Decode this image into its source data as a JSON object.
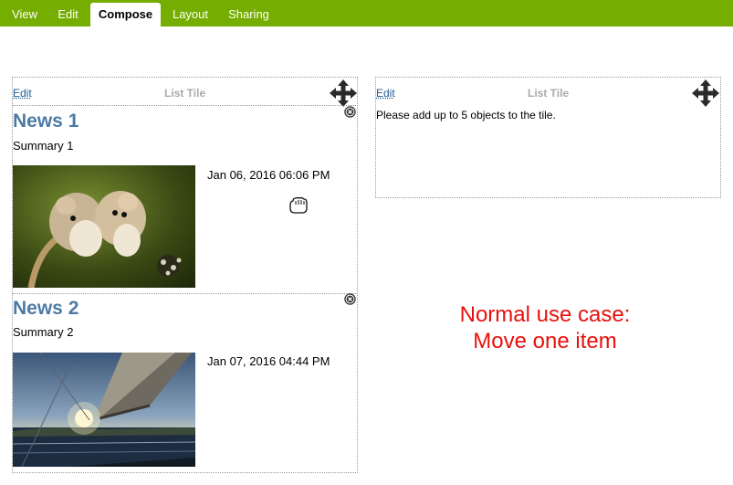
{
  "tabs": [
    {
      "label": "View"
    },
    {
      "label": "Edit"
    },
    {
      "label": "Compose",
      "active": true
    },
    {
      "label": "Layout"
    },
    {
      "label": "Sharing"
    }
  ],
  "colors": {
    "tabbar": "#75ad00",
    "link": "#205c90",
    "news_title": "#4d7ba5",
    "note": "#e8100c"
  },
  "left_tile": {
    "edit_label": "Edit",
    "title": "List Tile",
    "move_icon": "move-arrows-icon",
    "items": [
      {
        "title": "News 1",
        "summary": "Summary 1",
        "date": "Jan 06, 2016 06:06 PM",
        "image": "two-mice-photo",
        "remove_icon": "remove-circle-icon"
      },
      {
        "title": "News 2",
        "summary": "Summary 2",
        "date": "Jan 07, 2016 04:44 PM",
        "image": "sailboat-sunset-photo",
        "remove_icon": "remove-circle-icon"
      }
    ],
    "drag_cursor_icon": "grab-hand-icon"
  },
  "right_tile": {
    "edit_label": "Edit",
    "title": "List Tile",
    "move_icon": "move-arrows-icon",
    "message": "Please add up to 5 objects to the tile."
  },
  "annotation": {
    "line1": "Normal use case:",
    "line2": "Move one item"
  }
}
